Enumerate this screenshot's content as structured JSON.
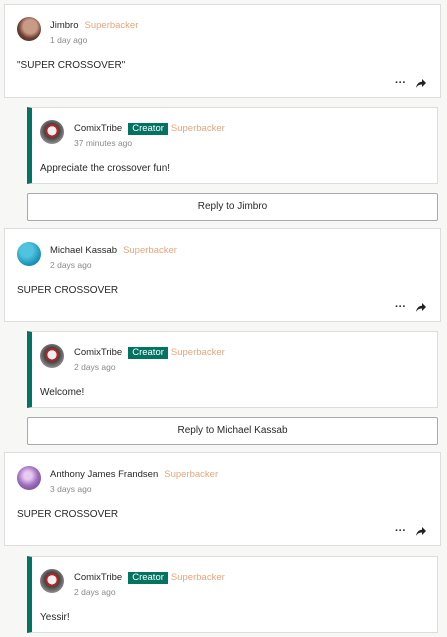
{
  "colors": {
    "creator_badge": "#037362",
    "superbacker": "#e7a57c",
    "reply_bar": "#037362"
  },
  "threads": [
    {
      "comment": {
        "author": "Jimbro",
        "role": "Superbacker",
        "time": "1 day ago",
        "text": "\"SUPER CROSSOVER\"",
        "avatar": "jimbro-avatar"
      },
      "reply": {
        "author": "ComixTribe",
        "creator": "Creator",
        "role": "Superbacker",
        "time": "37 minutes ago",
        "text": "Appreciate the crossover fun!"
      },
      "reply_button": "Reply to Jimbro"
    },
    {
      "comment": {
        "author": "Michael Kassab",
        "role": "Superbacker",
        "time": "2 days ago",
        "text": "SUPER CROSSOVER",
        "avatar": "michael-avatar"
      },
      "reply": {
        "author": "ComixTribe",
        "creator": "Creator",
        "role": "Superbacker",
        "time": "2 days ago",
        "text": "Welcome!"
      },
      "reply_button": "Reply to Michael Kassab"
    },
    {
      "comment": {
        "author": "Anthony James Frandsen",
        "role": "Superbacker",
        "time": "3 days ago",
        "text": "SUPER CROSSOVER",
        "avatar": "anthony-avatar"
      },
      "reply": {
        "author": "ComixTribe",
        "creator": "Creator",
        "role": "Superbacker",
        "time": "2 days ago",
        "text": "Yessir!"
      }
    }
  ]
}
